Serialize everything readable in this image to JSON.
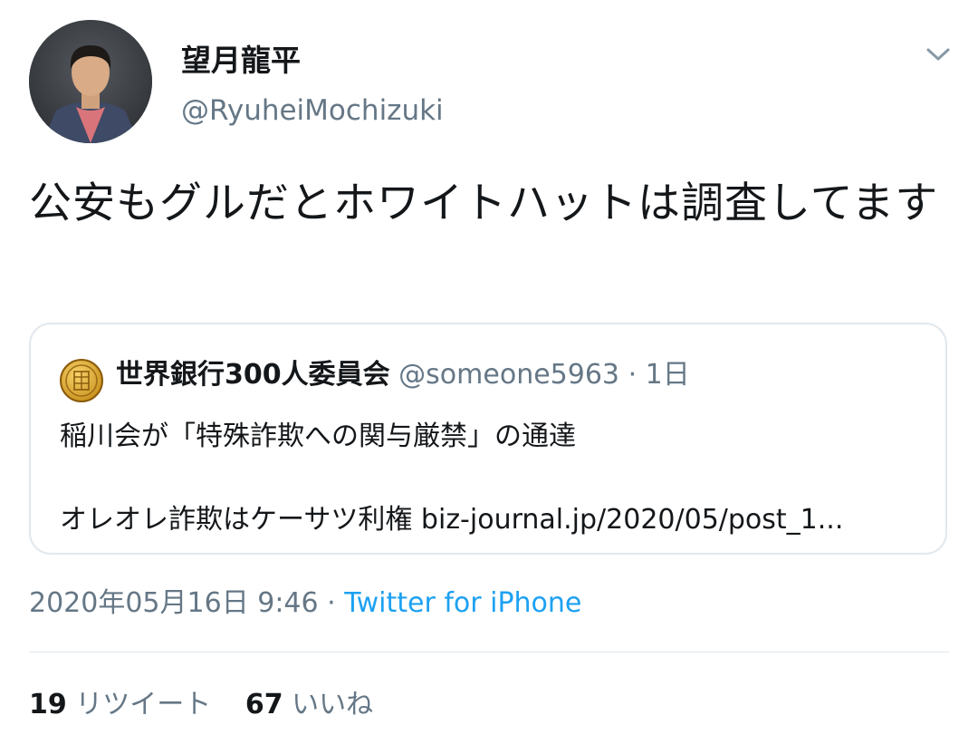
{
  "author": {
    "display_name": "望月龍平",
    "handle": "@RyuheiMochizuki",
    "avatar_icon": "profile-photo"
  },
  "tweet": {
    "text": "公安もグルだとホワイトハットは調査してます"
  },
  "quote": {
    "display_name": "世界銀行300人委員会",
    "handle": "@someone5963",
    "separator": "·",
    "time": "1日",
    "line1": "稲川会が「特殊詐欺への関与厳禁」の通達",
    "line2": "オレオレ詐欺はケーサツ利権 biz-journal.jp/2020/05/post_1...",
    "avatar_icon": "gold-coin-icon"
  },
  "meta": {
    "timestamp": "2020年05月16日 9:46",
    "separator": "·",
    "source": "Twitter for iPhone"
  },
  "stats": {
    "retweet_count": "19",
    "retweet_label": "リツイート",
    "like_count": "67",
    "like_label": "いいね"
  },
  "colors": {
    "text_primary": "#14171a",
    "text_secondary": "#657786",
    "link": "#1da1f2",
    "border": "#e1e8ed"
  },
  "icons": {
    "caret": "chevron-down-icon"
  }
}
